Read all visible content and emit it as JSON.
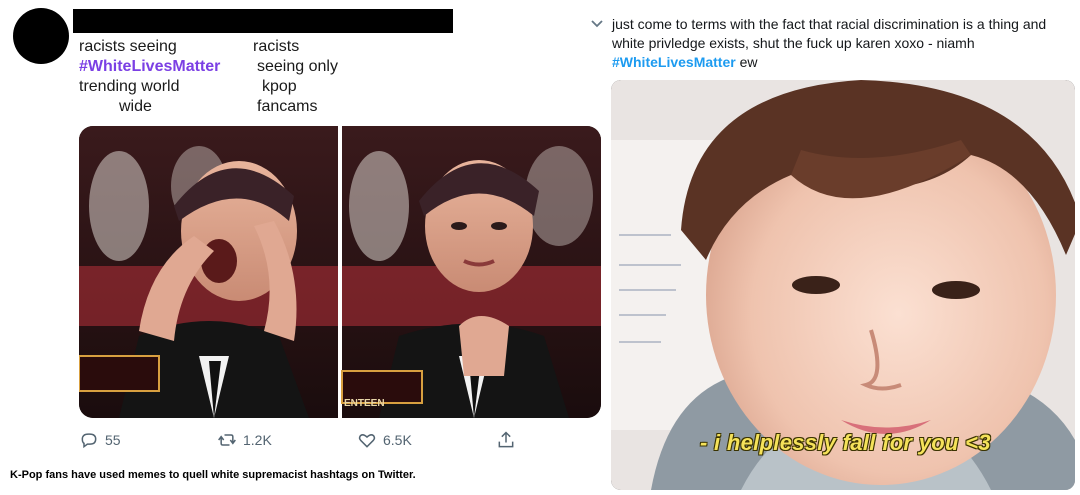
{
  "left_tweet": {
    "meme_left_lines": [
      "racists seeing",
      "#WhiteLivesMatter",
      "trending world",
      "wide"
    ],
    "meme_right_lines": [
      "racists",
      "seeing only",
      "kpop",
      "fancams"
    ],
    "replies": "55",
    "retweets": "1.2K",
    "likes": "6.5K",
    "badge_text": "ENTEEN"
  },
  "caption": "K-Pop fans have used memes to quell white supremacist hashtags on Twitter.",
  "right_tweet": {
    "text": "just come to terms with the fact that racial discrimination is a thing and white privledge exists, shut the fuck up karen xoxo - niamh",
    "hashtag": "#WhiteLivesMatter",
    "suffix": " ew",
    "subtitle": "- i helplessly fall for you <3"
  },
  "colors": {
    "hashtag_purple": "#7b3fe4",
    "hashtag_blue": "#1d9bf0",
    "metric_gray": "#536471",
    "subtitle_yellow": "#f5e25a"
  },
  "icons": [
    "chevron-down-icon",
    "reply-icon",
    "retweet-icon",
    "like-icon",
    "share-icon"
  ]
}
